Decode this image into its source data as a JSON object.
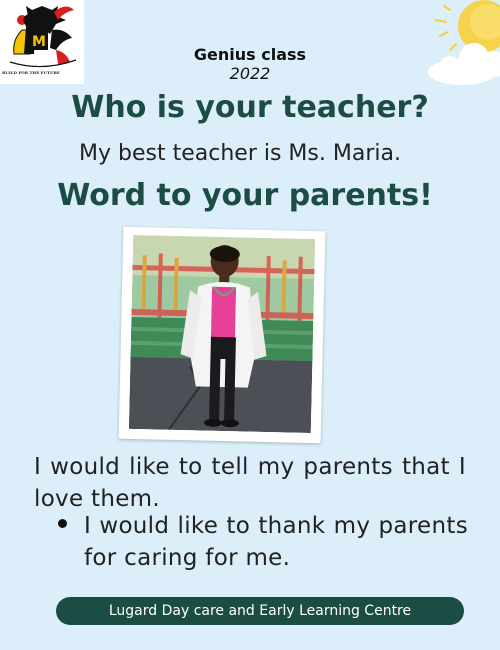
{
  "logo": {
    "motto": "BUILD FOR THE FUTURE"
  },
  "header": {
    "class_name": "Genius class",
    "year": "2022"
  },
  "teacher": {
    "question": "Who is your teacher?",
    "answer": "My best teacher is Ms. Maria."
  },
  "parents": {
    "heading": "Word to your parents!",
    "message": "I would like to tell my parents that I love them.",
    "bullet": "I would like to thank my parents for caring for me."
  },
  "footer": {
    "school_name": "Lugard Day care and Early Learning Centre"
  },
  "colors": {
    "heading": "#1c4d44",
    "background": "#dbeefa",
    "footer_bg": "#1c4d44"
  },
  "icons": [
    "school-logo",
    "sun-icon",
    "cloud-icon",
    "student-photo"
  ]
}
